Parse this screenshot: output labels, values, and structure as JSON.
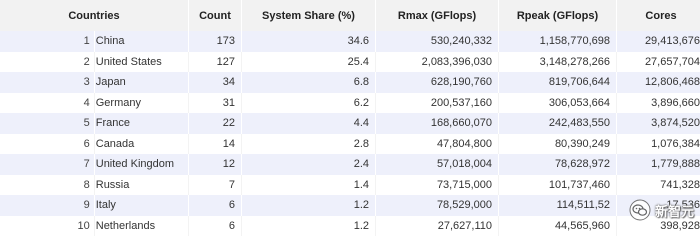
{
  "table": {
    "headers": {
      "countries": "Countries",
      "count": "Count",
      "share": "System Share (%)",
      "rmax": "Rmax (GFlops)",
      "rpeak": "Rpeak (GFlops)",
      "cores": "Cores"
    },
    "rows": [
      {
        "rank": "1",
        "country": "China",
        "count": "173",
        "share": "34.6",
        "rmax": "530,240,332",
        "rpeak": "1,158,770,698",
        "cores": "29,413,676"
      },
      {
        "rank": "2",
        "country": "United States",
        "count": "127",
        "share": "25.4",
        "rmax": "2,083,396,030",
        "rpeak": "3,148,278,266",
        "cores": "27,657,704"
      },
      {
        "rank": "3",
        "country": "Japan",
        "count": "34",
        "share": "6.8",
        "rmax": "628,190,760",
        "rpeak": "819,706,644",
        "cores": "12,806,468"
      },
      {
        "rank": "4",
        "country": "Germany",
        "count": "31",
        "share": "6.2",
        "rmax": "200,537,160",
        "rpeak": "306,053,664",
        "cores": "3,896,660"
      },
      {
        "rank": "5",
        "country": "France",
        "count": "22",
        "share": "4.4",
        "rmax": "168,660,070",
        "rpeak": "242,483,550",
        "cores": "3,874,520"
      },
      {
        "rank": "6",
        "country": "Canada",
        "count": "14",
        "share": "2.8",
        "rmax": "47,804,800",
        "rpeak": "80,390,249",
        "cores": "1,076,384"
      },
      {
        "rank": "7",
        "country": "United Kingdom",
        "count": "12",
        "share": "2.4",
        "rmax": "57,018,004",
        "rpeak": "78,628,972",
        "cores": "1,779,888"
      },
      {
        "rank": "8",
        "country": "Russia",
        "count": "7",
        "share": "1.4",
        "rmax": "73,715,000",
        "rpeak": "101,737,460",
        "cores": "741,328"
      },
      {
        "rank": "9",
        "country": "Italy",
        "count": "6",
        "share": "1.2",
        "rmax": "78,529,000",
        "rpeak": "114,511,52",
        "cores": "17,536"
      },
      {
        "rank": "10",
        "country": "Netherlands",
        "count": "6",
        "share": "1.2",
        "rmax": "27,627,110",
        "rpeak": "44,565,960",
        "cores": "398,928"
      }
    ]
  },
  "watermark": {
    "text": "新智元",
    "icon": "wechat-logo-icon"
  }
}
